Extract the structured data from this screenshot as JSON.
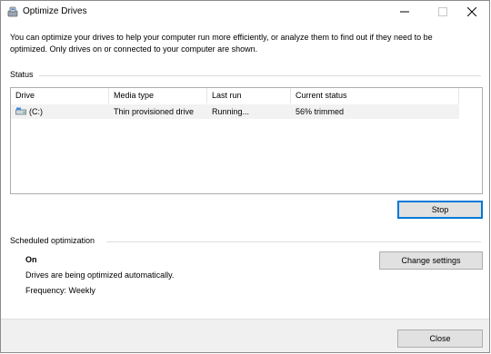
{
  "window": {
    "title": "Optimize Drives",
    "accent_color": "#0078d7"
  },
  "description": "You can optimize your drives to help your computer run more efficiently, or analyze them to find out if they need to be optimized. Only drives on or connected to your computer are shown.",
  "status": {
    "label": "Status",
    "columns": [
      "Drive",
      "Media type",
      "Last run",
      "Current status"
    ],
    "rows": [
      {
        "drive": "(C:)",
        "media_type": "Thin provisioned drive",
        "last_run": "Running...",
        "current_status": "56% trimmed"
      }
    ],
    "stop_label": "Stop"
  },
  "scheduled": {
    "label": "Scheduled optimization",
    "state": "On",
    "message": "Drives are being optimized automatically.",
    "frequency": "Frequency: Weekly",
    "change_label": "Change settings"
  },
  "footer": {
    "close_label": "Close"
  }
}
